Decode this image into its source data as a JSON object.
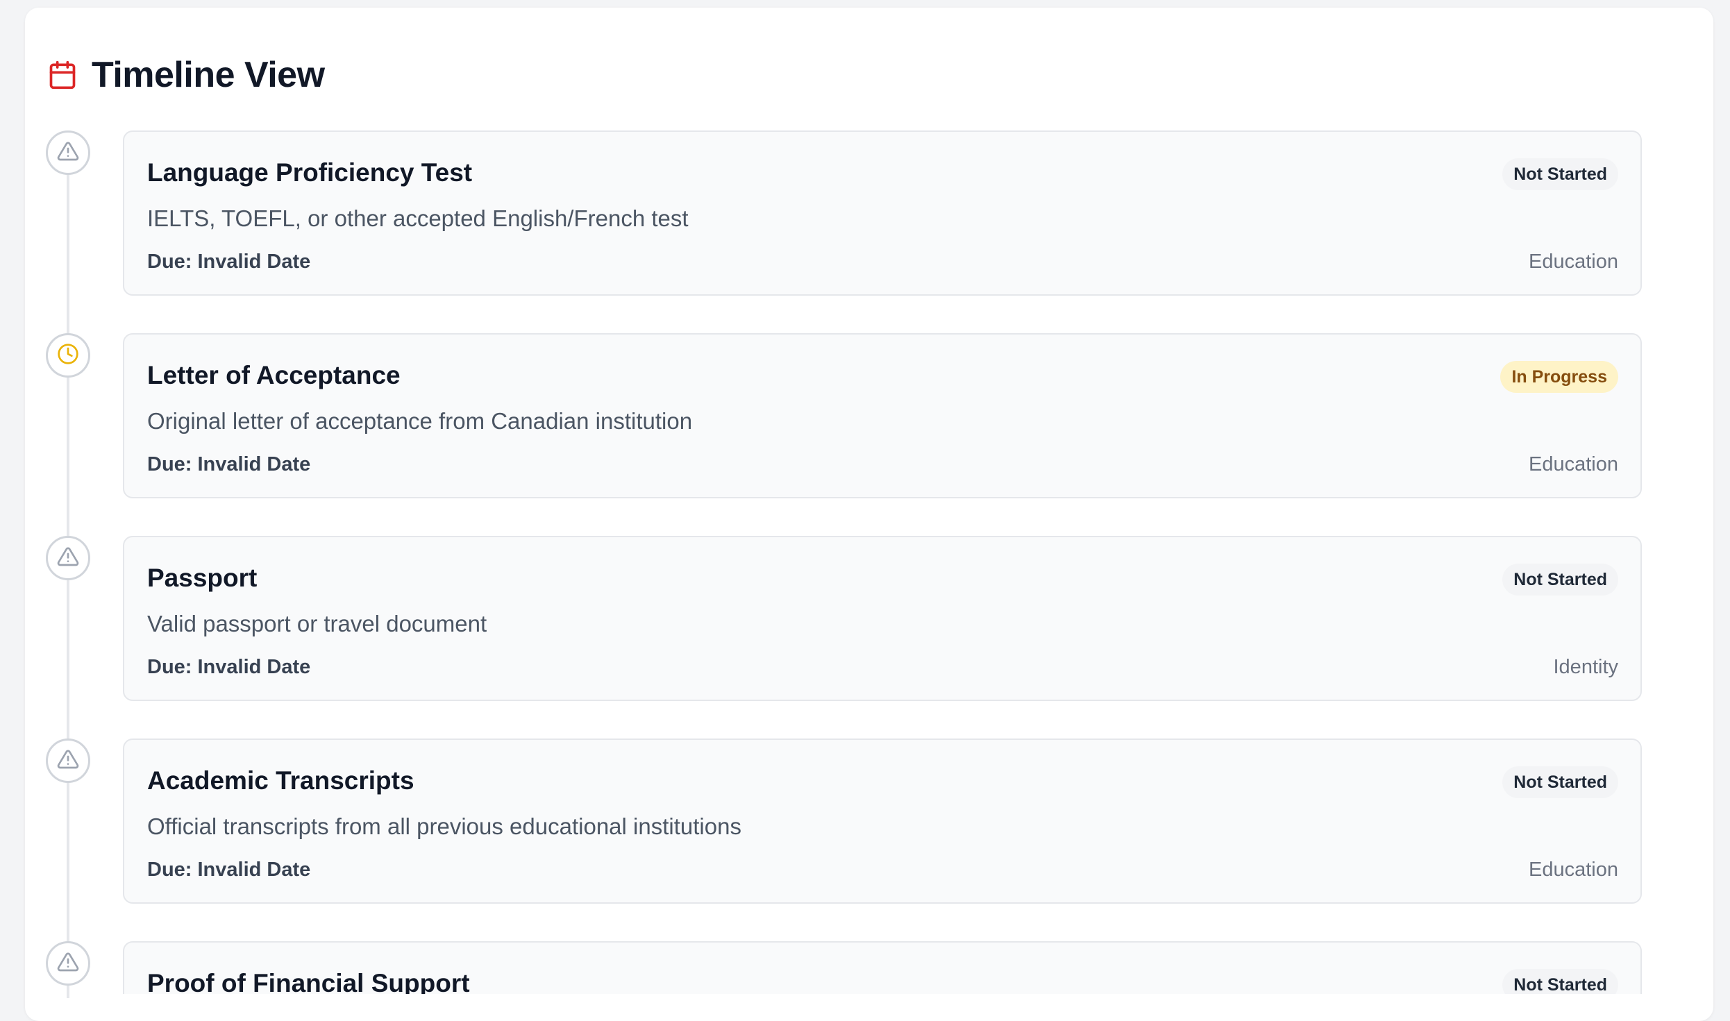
{
  "header": {
    "title": "Timeline View",
    "icon": "calendar-icon",
    "icon_color": "#dc2626"
  },
  "colors": {
    "pending_icon": "#9ca3af",
    "in_progress_icon": "#eab308",
    "not_started_badge_bg": "#f3f4f6",
    "in_progress_badge_bg": "#fef3c7"
  },
  "items": [
    {
      "title": "Language Proficiency Test",
      "description": "IELTS, TOEFL, or other accepted English/French test",
      "due": "Due: Invalid Date",
      "category": "Education",
      "status": "Not Started",
      "status_icon": "alert-triangle-icon"
    },
    {
      "title": "Letter of Acceptance",
      "description": "Original letter of acceptance from Canadian institution",
      "due": "Due: Invalid Date",
      "category": "Education",
      "status": "In Progress",
      "status_icon": "clock-icon"
    },
    {
      "title": "Passport",
      "description": "Valid passport or travel document",
      "due": "Due: Invalid Date",
      "category": "Identity",
      "status": "Not Started",
      "status_icon": "alert-triangle-icon"
    },
    {
      "title": "Academic Transcripts",
      "description": "Official transcripts from all previous educational institutions",
      "due": "Due: Invalid Date",
      "category": "Education",
      "status": "Not Started",
      "status_icon": "alert-triangle-icon"
    },
    {
      "title": "Proof of Financial Support",
      "description": "",
      "due": "",
      "category": "",
      "status": "Not Started",
      "status_icon": "alert-triangle-icon"
    }
  ]
}
